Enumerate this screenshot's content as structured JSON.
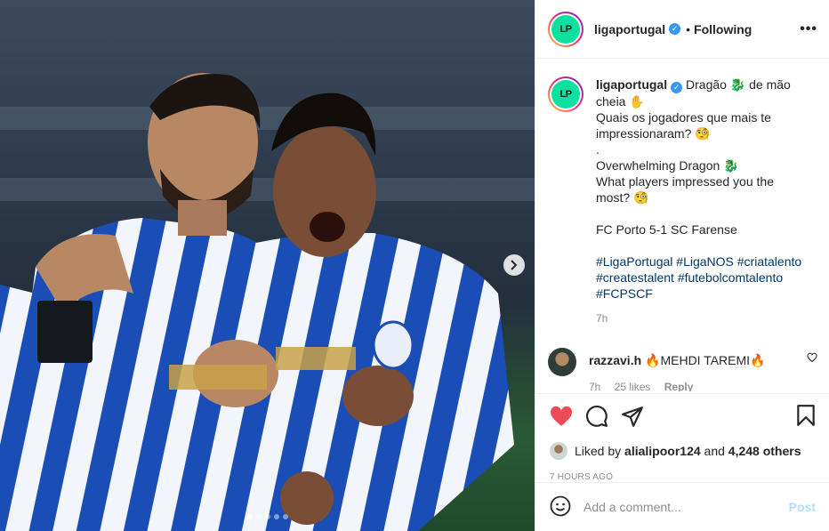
{
  "post": {
    "username": "ligaportugal",
    "avatar_text": "LP",
    "separator": "•",
    "following_label": "Following",
    "more_label": "•••"
  },
  "caption": {
    "username": "ligaportugal",
    "lines": [
      "Dragão 🐉 de mão cheia ✋",
      "Quais os jogadores que mais te impressionaram? 🧐",
      ".",
      "Overwhelming Dragon 🐉",
      "What players impressed you the most? 🧐",
      "",
      "FC Porto 5-1 SC Farense",
      ""
    ],
    "hashtags": "#LigaPortugal #LigaNOS #criatalento #createstalent #futebolcomtalento #FCPSCF",
    "time": "7h"
  },
  "comment": {
    "username": "razzavi.h",
    "text": "🔥MEHDI TAREMI🔥",
    "time": "7h",
    "likes": "25 likes",
    "reply": "Reply"
  },
  "likes": {
    "prefix": "Liked by",
    "user": "alialipoor124",
    "and": "and",
    "count": "4,248 others"
  },
  "posted": "7 HOURS AGO",
  "add_comment": {
    "placeholder": "Add a comment...",
    "post_label": "Post"
  },
  "carousel": {
    "slides": 5,
    "active_index": 0
  },
  "colors": {
    "like_red": "#ed4956",
    "verified_blue": "#3897f0",
    "hashtag": "#00376b",
    "post_disabled": "#b2dffc"
  }
}
